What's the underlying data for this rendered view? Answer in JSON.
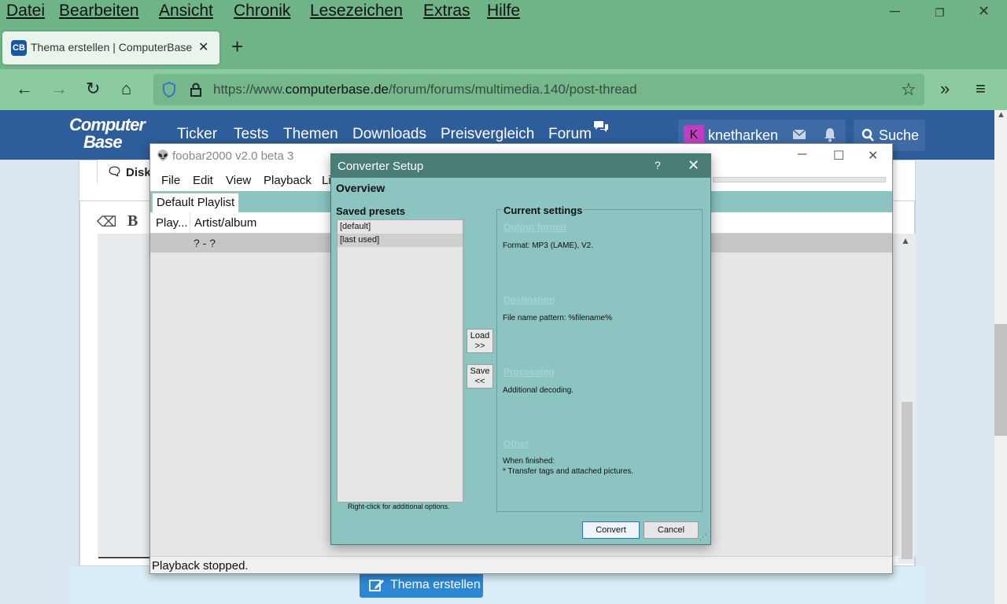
{
  "browser": {
    "menu": [
      "Datei",
      "Bearbeiten",
      "Ansicht",
      "Chronik",
      "Lesezeichen",
      "Extras",
      "Hilfe"
    ],
    "tab_title": "Thema erstellen | ComputerBase",
    "tab_favicon": "CB",
    "url_prefix": "https://www.",
    "url_domain": "computerbase.de",
    "url_path": "/forum/forums/multimedia.140/post-thread"
  },
  "site": {
    "logo_line1": "Computer",
    "logo_line2": "Base",
    "nav": [
      "Ticker",
      "Tests",
      "Themen",
      "Downloads",
      "Preisvergleich",
      "Forum"
    ],
    "avatar_letter": "K",
    "username": "knetharken",
    "search_label": "Suche",
    "tab_label": "Disk",
    "bold_label": "B",
    "submit_button": "Thema erstellen"
  },
  "foobar": {
    "title": "foobar2000 v2.0 beta 3",
    "menu": [
      "File",
      "Edit",
      "View",
      "Playback",
      "Li"
    ],
    "playlist_tab": "Default Playlist",
    "columns": [
      "Play...",
      "Artist/album"
    ],
    "row_text": "? - ?",
    "status": "Playback stopped."
  },
  "converter": {
    "title": "Converter Setup",
    "help": "?",
    "overview": "Overview",
    "saved_presets_label": "Saved presets",
    "presets": [
      "[default]",
      "[last used]"
    ],
    "selected_preset": "[last used]",
    "hint": "Right-click for additional options.",
    "load_button": "Load\n>>",
    "save_button": "Save\n<<",
    "current_settings_label": "Current settings",
    "sections": [
      {
        "link": "Output format",
        "value": "Format: MP3 (LAME), V2."
      },
      {
        "link": "Destination",
        "value": "File name pattern: %filename%"
      },
      {
        "link": "Processing",
        "value": "Additional decoding."
      },
      {
        "link": "Other",
        "value": "When finished:\n* Transfer tags and attached pictures."
      }
    ],
    "convert_button": "Convert",
    "cancel_button": "Cancel"
  }
}
